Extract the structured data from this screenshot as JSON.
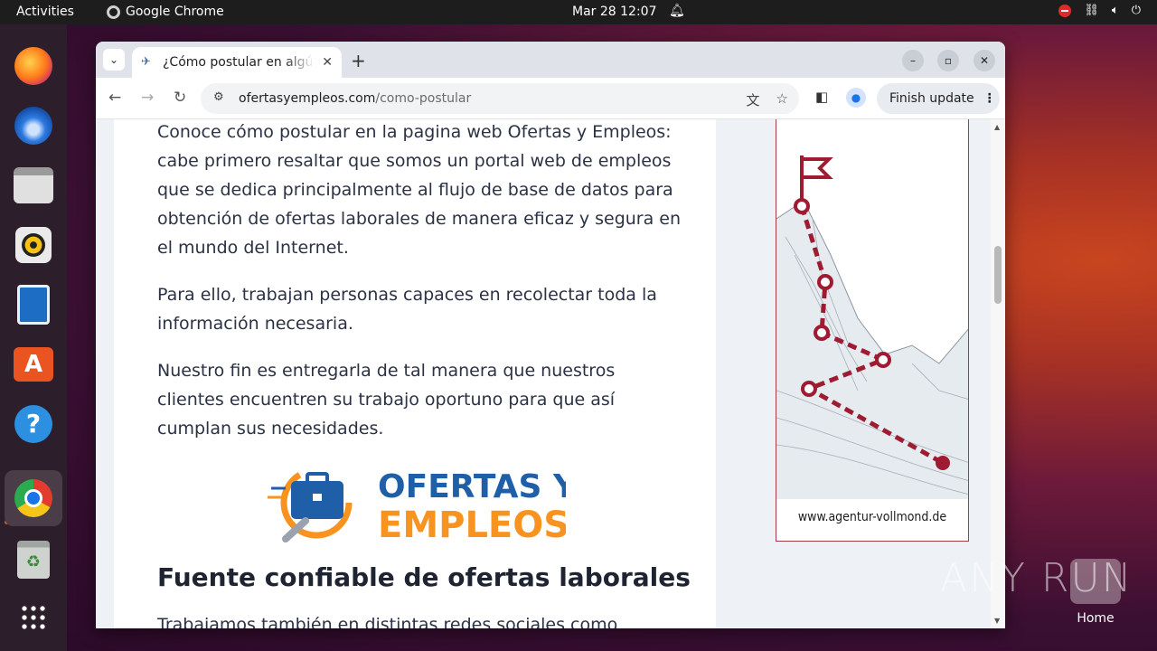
{
  "topbar": {
    "activities": "Activities",
    "app_name": "Google Chrome",
    "clock": "Mar 28  12:07"
  },
  "dock": {
    "items": [
      "firefox-icon",
      "thunderbird-icon",
      "files-icon",
      "rhythmbox-icon",
      "writer-icon",
      "software-icon",
      "help-icon",
      "chrome-icon",
      "trash-icon",
      "apps-grid-icon"
    ]
  },
  "browser": {
    "tab_title": "¿Cómo postular en algún empleo",
    "url_host": "ofertasyempleos.com",
    "url_path": "/como-postular",
    "finish_update": "Finish update"
  },
  "page": {
    "paragraphs": [
      "Conoce cómo postular en la pagina web Ofertas y Empleos: cabe primero resaltar que somos un portal web de empleos que se dedica principalmente al flujo de base de datos para obtención de ofertas laborales de manera eficaz y segura en el mundo del Internet.",
      "Para ello, trabajan personas capaces en recolectar toda la información necesaria.",
      "Nuestro fin es entregarla de tal manera que nuestros clientes encuentren su trabajo oportuno para que así cumplan sus necesidades."
    ],
    "logo_line1": "OFERTAS Y",
    "logo_line2": "EMPLEOS",
    "heading": "Fuente confiable de ofertas laborales",
    "cut_text": "Trabajamos también en distintas redes sociales como"
  },
  "ad": {
    "url": "www.agentur-vollmond.de",
    "accent": "#9e1b32"
  },
  "desktop": {
    "watermark": "ANY RUN",
    "home_label": "Home"
  }
}
